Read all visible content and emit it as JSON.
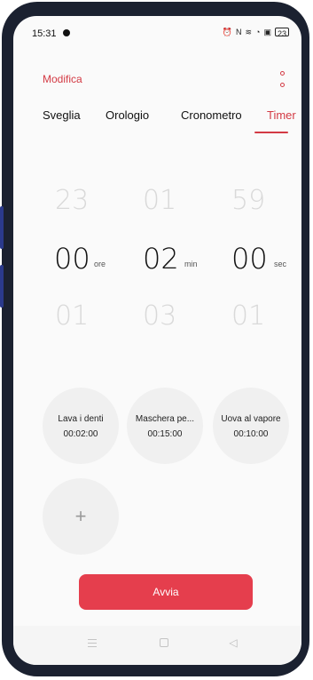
{
  "status_bar": {
    "time": "15:31",
    "icons": [
      "alarm-icon",
      "nfc-icon",
      "vibrate-icon",
      "wifi-icon",
      "sim-icon"
    ],
    "battery": "23"
  },
  "header": {
    "edit_label": "Modifica"
  },
  "tabs": [
    {
      "label": "Sveglia",
      "active": false
    },
    {
      "label": "Orologio",
      "active": false
    },
    {
      "label": "Cronometro",
      "active": false
    },
    {
      "label": "Timer",
      "active": true
    }
  ],
  "picker": {
    "hours": {
      "prev": "23",
      "selected": "00",
      "next": "01",
      "unit": "ore"
    },
    "minutes": {
      "prev": "01",
      "selected": "02",
      "next": "03",
      "unit": "min"
    },
    "seconds": {
      "prev": "59",
      "selected": "00",
      "next": "01",
      "unit": "sec"
    }
  },
  "presets": [
    {
      "name": "Lava i denti",
      "time": "00:02:00"
    },
    {
      "name": "Maschera pe...",
      "time": "00:15:00"
    },
    {
      "name": "Uova al vapore",
      "time": "00:10:00"
    }
  ],
  "add_label": "+",
  "start_label": "Avvia",
  "colors": {
    "accent": "#d33a44",
    "button": "#e53e4d",
    "preset_bg": "#f0f0f0"
  }
}
